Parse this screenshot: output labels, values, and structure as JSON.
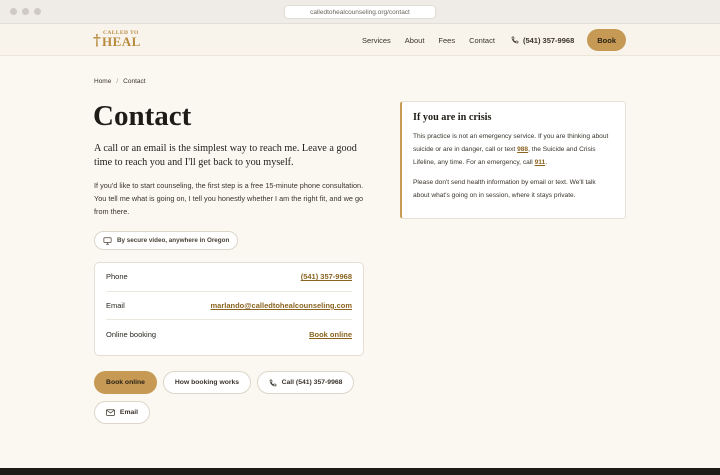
{
  "browser": {
    "url": "calledtohealcounseling.org/contact"
  },
  "header": {
    "logo_top": "CALLED TO",
    "logo_main": "HEAL",
    "logo_cross": "†",
    "nav": [
      "Services",
      "About",
      "Fees",
      "Contact"
    ],
    "phone": "(541) 357-9968",
    "book_label": "Book"
  },
  "breadcrumb": {
    "home": "Home",
    "separator": "/",
    "current": "Contact"
  },
  "page": {
    "title": "Contact",
    "lead": "A call or an email is the simplest way to reach me. Leave a good time to reach you and I'll get back to you myself.",
    "paragraph": "If you'd like to start counseling, the first step is a free 15-minute phone consultation. You tell me what is going on, I tell you honestly whether I am the right fit, and we go from there.",
    "chip": "By secure video, anywhere in Oregon"
  },
  "contacts": [
    {
      "label": "Phone",
      "value": "(541) 357-9968"
    },
    {
      "label": "Email",
      "value": "marlando@calledtohealcounseling.com"
    },
    {
      "label": "Online booking",
      "value": "Book online"
    }
  ],
  "buttons": {
    "book_online": "Book online",
    "how_booking": "How booking works",
    "call": "Call (541) 357-9968",
    "email": "Email"
  },
  "crisis": {
    "title": "If you are in crisis",
    "p1_a": "This practice is not an emergency service. If you are thinking about suicide or are in danger, call or text ",
    "p1_988": "988",
    "p1_b": ", the Suicide and Crisis Lifeline, any time. For an emergency, call ",
    "p1_911": "911",
    "p1_c": ".",
    "p2": "Please don't send health information by email or text. We'll talk about what's going on in session, where it stays private."
  },
  "colors": {
    "accent": "#c69a54",
    "link": "#8a6420",
    "background": "#fbf8f2",
    "footer": "#1e1a16"
  },
  "icons": {
    "phone": "phone-icon",
    "video": "monitor-icon",
    "email": "mail-icon"
  }
}
